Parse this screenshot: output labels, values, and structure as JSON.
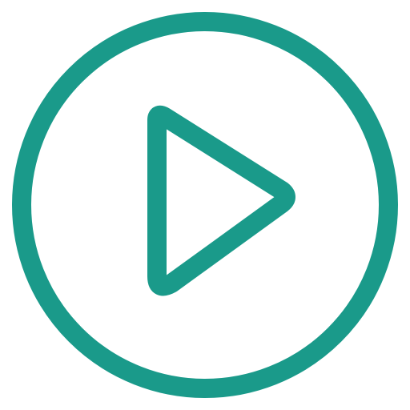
{
  "icon": {
    "name": "play-circle-icon",
    "color": "#1a9a8a",
    "background": "#ffffff"
  }
}
